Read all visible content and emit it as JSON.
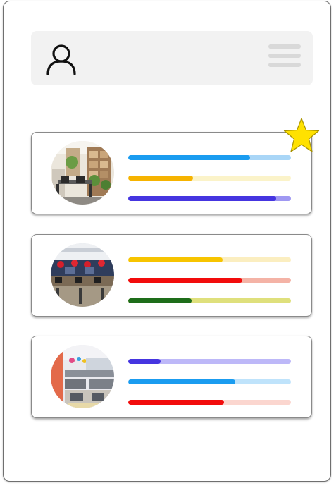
{
  "header": {
    "profile_icon": "user-icon",
    "menu_icon": "hamburger-menu-icon"
  },
  "favorite_icon": "star-icon",
  "colors": {
    "star": "#ffe100",
    "menu_lines": "#d9d9d9",
    "header_bg": "#f2f2f2"
  },
  "cards": [
    {
      "image": "office-room-with-plants-and-shelves",
      "favorite": true,
      "bars": [
        {
          "value": 0.75,
          "color": "#1a9cf0",
          "track": "#a9d6f7"
        },
        {
          "value": 0.4,
          "color": "#f6b300",
          "track": "#fbf3c9"
        },
        {
          "value": 0.91,
          "color": "#4535e0",
          "track": "#9f98f2"
        }
      ]
    },
    {
      "image": "office-desks-with-red-decorations",
      "favorite": false,
      "bars": [
        {
          "value": 0.58,
          "color": "#f7c400",
          "track": "#fbeec0"
        },
        {
          "value": 0.7,
          "color": "#f20c0c",
          "track": "#f4b3a6"
        },
        {
          "value": 0.39,
          "color": "#1e6d1a",
          "track": "#dfe07c"
        }
      ]
    },
    {
      "image": "open-plan-office-cubicles",
      "favorite": false,
      "bars": [
        {
          "value": 0.2,
          "color": "#4535e0",
          "track": "#bdb8f8"
        },
        {
          "value": 0.66,
          "color": "#1a9cf0",
          "track": "#bfe3fb"
        },
        {
          "value": 0.59,
          "color": "#f20c0c",
          "track": "#fbd6cf"
        }
      ]
    }
  ]
}
